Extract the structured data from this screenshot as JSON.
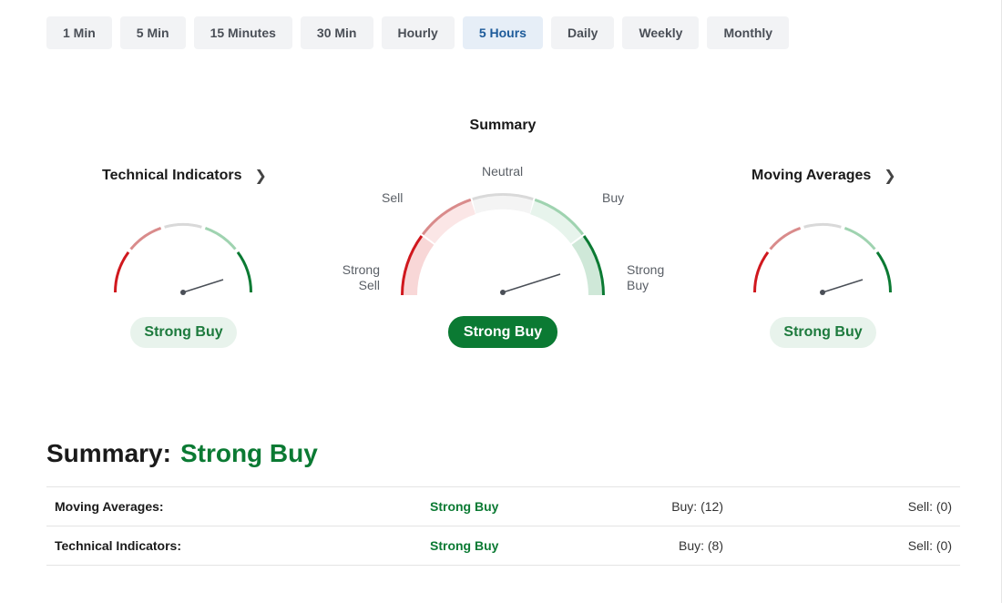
{
  "timeframes": [
    {
      "label": "1 Min",
      "active": false
    },
    {
      "label": "5 Min",
      "active": false
    },
    {
      "label": "15 Minutes",
      "active": false
    },
    {
      "label": "30 Min",
      "active": false
    },
    {
      "label": "Hourly",
      "active": false
    },
    {
      "label": "5 Hours",
      "active": true
    },
    {
      "label": "Daily",
      "active": false
    },
    {
      "label": "Weekly",
      "active": false
    },
    {
      "label": "Monthly",
      "active": false
    }
  ],
  "summary_section": {
    "title": "Summary",
    "labels": {
      "strong_sell_1": "Strong",
      "strong_sell_2": "Sell",
      "sell": "Sell",
      "neutral": "Neutral",
      "buy": "Buy",
      "strong_buy_1": "Strong",
      "strong_buy_2": "Buy"
    },
    "result": "Strong Buy"
  },
  "technical_indicators": {
    "title": "Technical Indicators",
    "result": "Strong Buy"
  },
  "moving_averages": {
    "title": "Moving Averages",
    "result": "Strong Buy"
  },
  "colors": {
    "strong_sell": "#d0181e",
    "sell": "#d98b8b",
    "neutral": "#d9d9d9",
    "buy": "#9fd3b0",
    "strong_buy": "#0b7a33",
    "active_tab_bg": "#e6eef7"
  },
  "overall": {
    "label": "Summary:",
    "value": "Strong Buy"
  },
  "table": [
    {
      "name": "Moving Averages:",
      "value": "Strong Buy",
      "buy": "Buy: (12)",
      "sell": "Sell: (0)"
    },
    {
      "name": "Technical Indicators:",
      "value": "Strong Buy",
      "buy": "Buy: (8)",
      "sell": "Sell: (0)"
    }
  ]
}
